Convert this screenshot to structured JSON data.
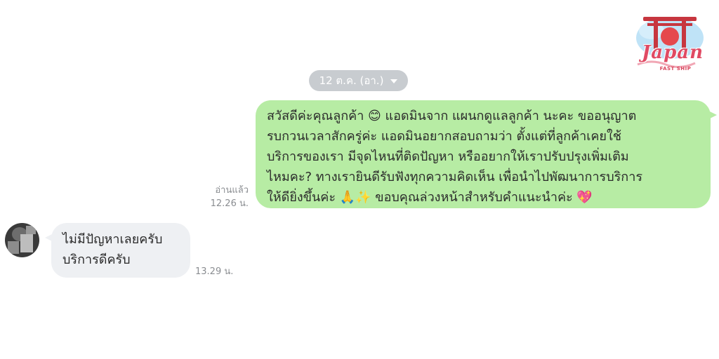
{
  "logo": {
    "title": "Japan",
    "subtitle": "FAST SHIP",
    "colors": {
      "primary": "#e04a63",
      "sky": "#bfe3f7"
    }
  },
  "date_separator": {
    "label": "12 ต.ค. (อา.)",
    "icon": "caret-down-icon"
  },
  "messages": [
    {
      "direction": "outgoing",
      "lines": [
        "สวัสดีค่ะคุณลูกค้า 😊 แอดมินจาก แผนกดูแลลูกค้า นะคะ ขออนุญาต",
        "รบกวนเวลาสักครู่ค่ะ แอดมินอยากสอบถามว่า ตั้งแต่ที่ลูกค้าเคยใช้",
        "บริการของเรา มีจุดไหนที่ติดปัญหา หรืออยากให้เราปรับปรุงเพิ่มเติม",
        "ไหมคะ? ทางเรายินดีรับฟังทุกความคิดเห็น เพื่อนำไปพัฒนาการบริการ",
        "ให้ดียิ่งขึ้นค่ะ 🙏✨ ขอบคุณล่วงหน้าสำหรับคำแนะนำค่ะ 💖"
      ],
      "read_status": "อ่านแล้ว",
      "time": "12.26 น.",
      "bubble_color": "#b7eca4"
    },
    {
      "direction": "incoming",
      "lines": [
        "ไม่มีปัญหาเลยครับ",
        "บริการดีครับ"
      ],
      "time": "13.29 น.",
      "bubble_color": "#eef0f3"
    }
  ]
}
